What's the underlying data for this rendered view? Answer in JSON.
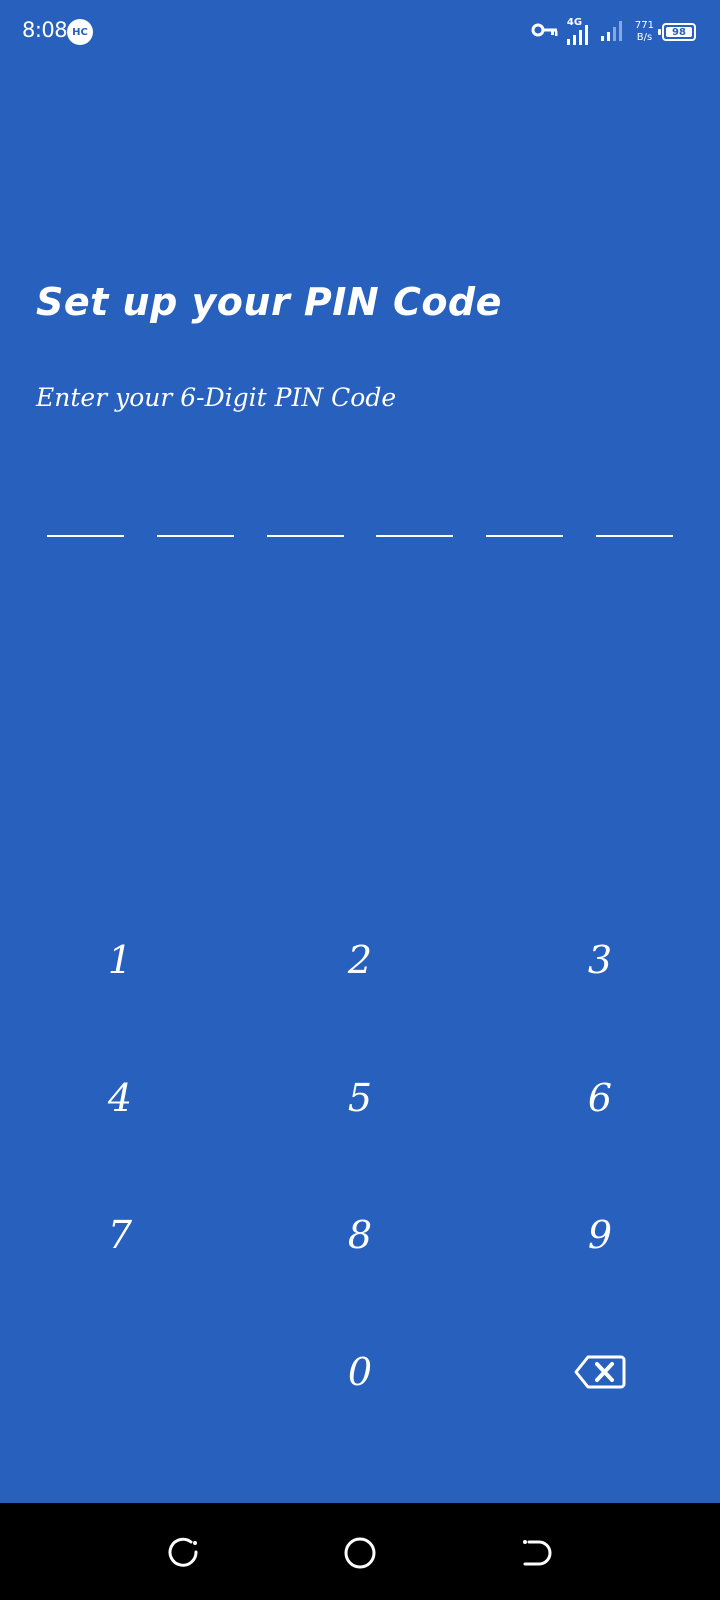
{
  "status_bar": {
    "time": "8:08",
    "badge": "HC",
    "network_type": "4G",
    "speed_value": "771",
    "speed_unit": "B/s",
    "battery_level": "98",
    "icons": [
      "vpn-key-icon",
      "signal-icon",
      "signal-weak-icon",
      "battery-icon"
    ]
  },
  "screen": {
    "title": "Set up your PIN Code",
    "subtitle": "Enter your 6-Digit PIN Code",
    "pin_length": 6
  },
  "keypad": {
    "keys": [
      "1",
      "2",
      "3",
      "4",
      "5",
      "6",
      "7",
      "8",
      "9",
      "0"
    ],
    "backspace_icon": "backspace-icon"
  },
  "nav_bar": {
    "icons": [
      "recent-apps-icon",
      "home-icon",
      "back-icon"
    ]
  },
  "colors": {
    "background": "#2860bd",
    "foreground": "#ffffff",
    "nav_background": "#000000"
  }
}
